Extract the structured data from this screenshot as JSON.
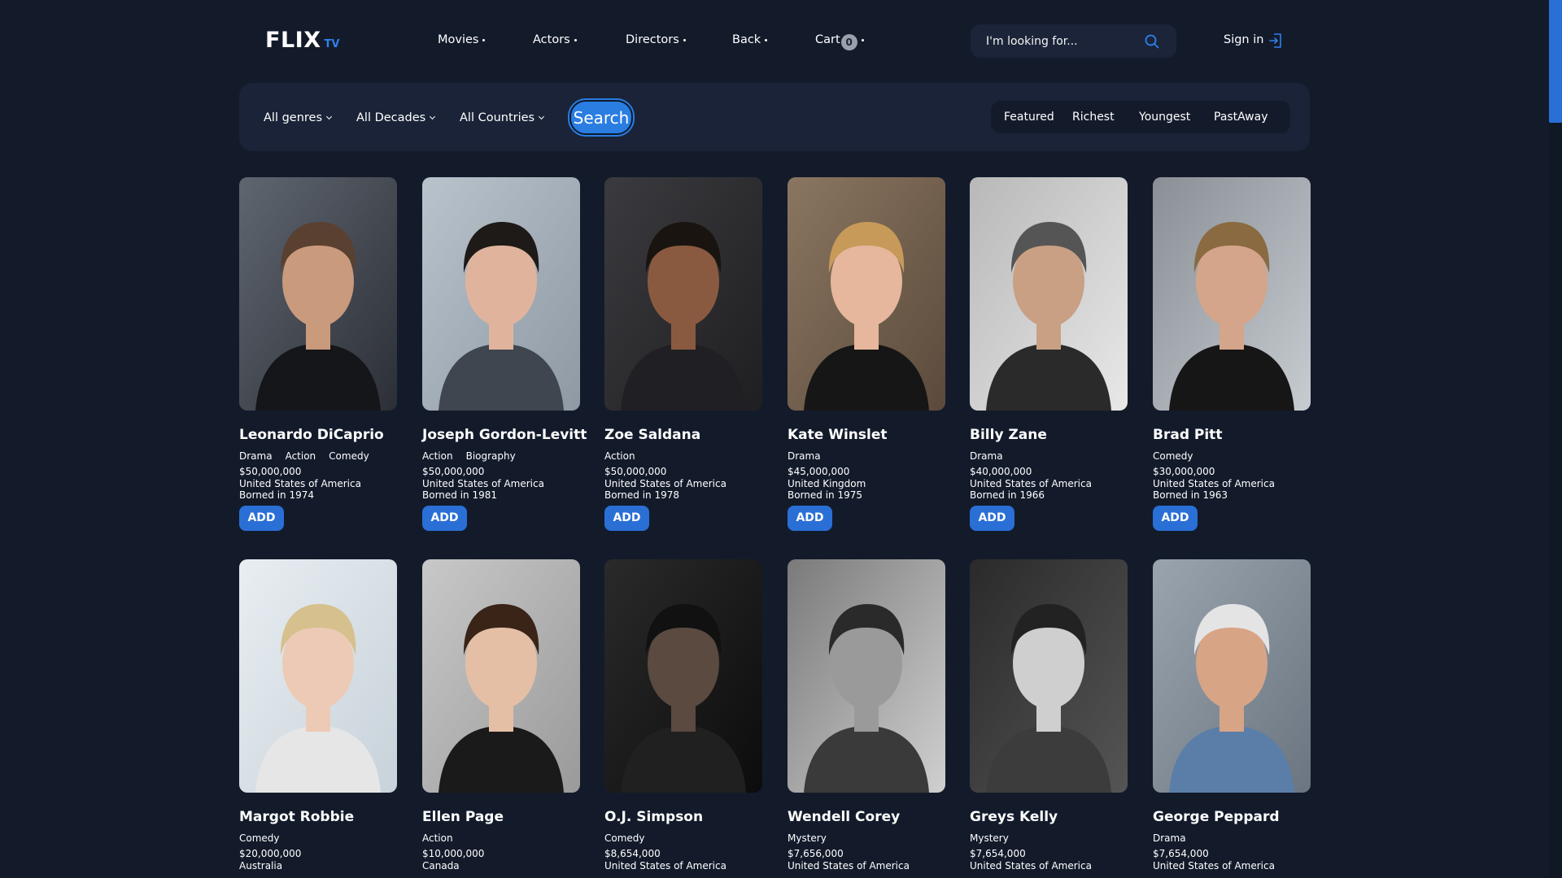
{
  "header": {
    "logo_main": "FLIX",
    "logo_sub": "TV",
    "nav": [
      "Movies",
      "Actors",
      "Directors",
      "Back",
      "Cart"
    ],
    "cart_count": "0",
    "search_placeholder": "I'm looking for...",
    "signin": "Sign in"
  },
  "filters": {
    "genres": "All genres",
    "decades": "All Decades",
    "countries": "All Countries",
    "search_button": "Search",
    "sort": [
      "Featured",
      "Richest",
      "Youngest",
      "PastAway"
    ]
  },
  "actors": [
    {
      "name": "Leonardo DiCaprio",
      "genres": [
        "Drama",
        "Action",
        "Comedy"
      ],
      "worth": "$50,000,000",
      "country": "United States of America",
      "born": "Borned in 1974"
    },
    {
      "name": "Joseph Gordon-Levitt",
      "genres": [
        "Action",
        "Biography"
      ],
      "worth": "$50,000,000",
      "country": "United States of America",
      "born": "Borned in 1981"
    },
    {
      "name": "Zoe Saldana",
      "genres": [
        "Action"
      ],
      "worth": "$50,000,000",
      "country": "United States of America",
      "born": "Borned in 1978"
    },
    {
      "name": "Kate Winslet",
      "genres": [
        "Drama"
      ],
      "worth": "$45,000,000",
      "country": "United Kingdom",
      "born": "Borned in 1975"
    },
    {
      "name": "Billy Zane",
      "genres": [
        "Drama"
      ],
      "worth": "$40,000,000",
      "country": "United States of America",
      "born": "Borned in 1966"
    },
    {
      "name": "Brad Pitt",
      "genres": [
        "Comedy"
      ],
      "worth": "$30,000,000",
      "country": "United States of America",
      "born": "Borned in 1963"
    },
    {
      "name": "Margot Robbie",
      "genres": [
        "Comedy"
      ],
      "worth": "$20,000,000",
      "country": "Australia",
      "born": ""
    },
    {
      "name": "Ellen Page",
      "genres": [
        "Action"
      ],
      "worth": "$10,000,000",
      "country": "Canada",
      "born": ""
    },
    {
      "name": "O.J. Simpson",
      "genres": [
        "Comedy"
      ],
      "worth": "$8,654,000",
      "country": "United States of America",
      "born": ""
    },
    {
      "name": "Wendell Corey",
      "genres": [
        "Mystery"
      ],
      "worth": "$7,656,000",
      "country": "United States of America",
      "born": ""
    },
    {
      "name": "Greys Kelly",
      "genres": [
        "Mystery"
      ],
      "worth": "$7,654,000",
      "country": "United States of America",
      "born": ""
    },
    {
      "name": "George Peppard",
      "genres": [
        "Drama"
      ],
      "worth": "$7,654,000",
      "country": "United States of America",
      "born": ""
    }
  ],
  "add_label": "ADD",
  "icons": {
    "search": "search-icon",
    "signin": "sign-in-icon"
  },
  "colors": {
    "background": "#131b2b",
    "panel": "#1a2337",
    "accent": "#2a6fd6"
  }
}
